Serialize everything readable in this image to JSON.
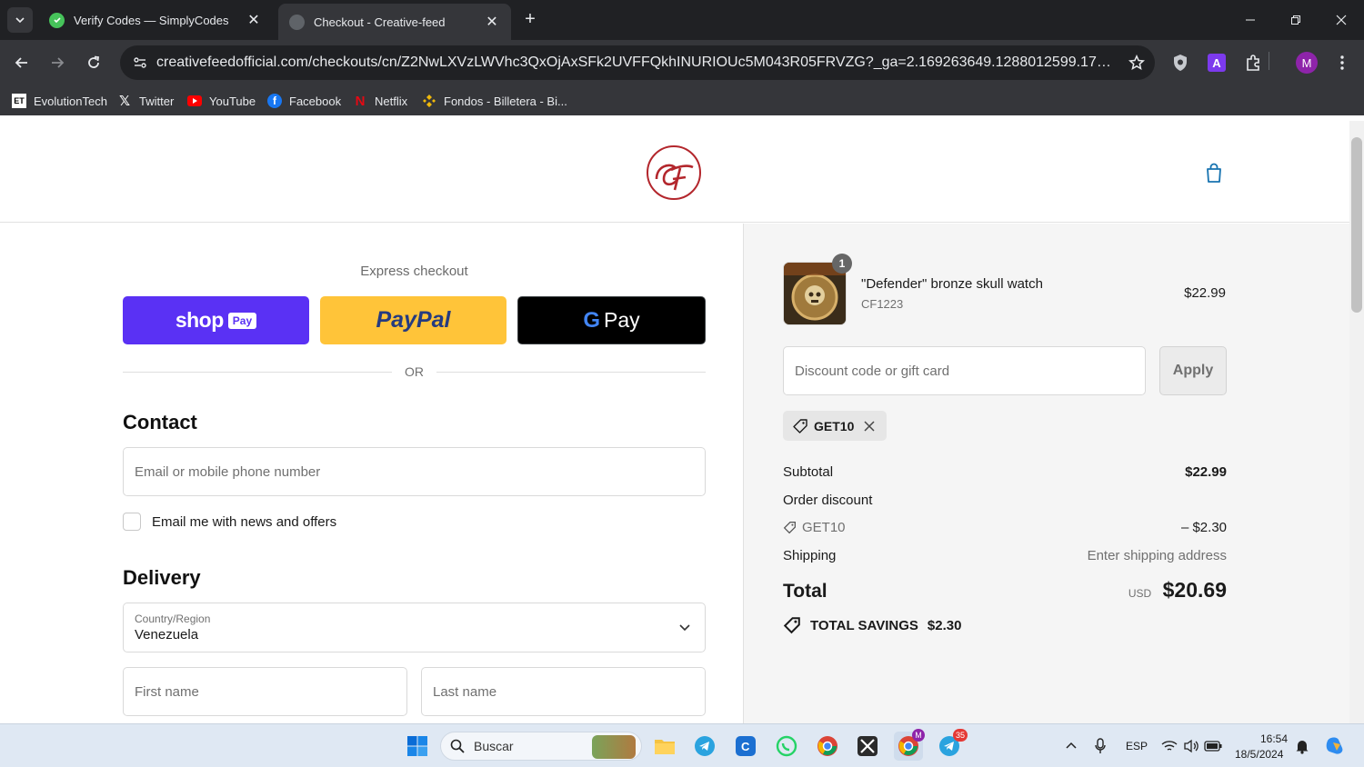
{
  "browser": {
    "tabs": [
      {
        "title": "Verify Codes — SimplyCodes",
        "active": false,
        "favicon_color": "#46c35a"
      },
      {
        "title": "Checkout - Creative-feed",
        "active": true,
        "favicon_color": "#8a8a8a"
      }
    ],
    "url": "creativefeedofficial.com/checkouts/cn/Z2NwLXVzLWVhc3QxOjAxSFk2UVFFQkhINURIOUc5M043R05FRVZG?_ga=2.169263649.1288012599.1716065640-2...",
    "profile_initial": "M",
    "bookmarks": [
      {
        "label": "EvolutionTech",
        "icon": "evolutiontech-icon"
      },
      {
        "label": "Twitter",
        "icon": "x-icon"
      },
      {
        "label": "YouTube",
        "icon": "youtube-icon"
      },
      {
        "label": "Facebook",
        "icon": "facebook-icon"
      },
      {
        "label": "Netflix",
        "icon": "netflix-icon"
      },
      {
        "label": "Fondos - Billetera - Bi...",
        "icon": "binance-icon"
      }
    ]
  },
  "checkout": {
    "express_title": "Express checkout",
    "pay_buttons": {
      "shop": "shop",
      "shop_pay": "Pay",
      "paypal": "PayPal",
      "gpay": "Pay"
    },
    "or_text": "OR",
    "contact": {
      "heading": "Contact",
      "email_placeholder": "Email or mobile phone number",
      "newsletter_label": "Email me with news and offers"
    },
    "delivery": {
      "heading": "Delivery",
      "country_label": "Country/Region",
      "country_value": "Venezuela",
      "first_name_placeholder": "First name",
      "last_name_placeholder": "Last name"
    }
  },
  "summary": {
    "product": {
      "name": "\"Defender\" bronze skull watch",
      "sku": "CF1223",
      "price": "$22.99",
      "quantity": "1"
    },
    "discount_placeholder": "Discount code or gift card",
    "apply_label": "Apply",
    "applied_code": "GET10",
    "subtotal_label": "Subtotal",
    "subtotal_value": "$22.99",
    "order_discount_label": "Order discount",
    "discount_code_label": "GET10",
    "discount_value": "– $2.30",
    "shipping_label": "Shipping",
    "shipping_value": "Enter shipping address",
    "total_label": "Total",
    "total_currency": "USD",
    "total_value": "$20.69",
    "savings_label": "TOTAL SAVINGS",
    "savings_value": "$2.30"
  },
  "taskbar": {
    "search_label": "Buscar",
    "language": "ESP",
    "time": "16:54",
    "date": "18/5/2024",
    "chrome_badge": "M",
    "telegram_badge": "35"
  },
  "colors": {
    "shop_pay": "#5a31f4",
    "paypal": "#ffc439",
    "gpay": "#000000",
    "logo_red": "#b3262c",
    "cart_blue": "#1773b0"
  }
}
